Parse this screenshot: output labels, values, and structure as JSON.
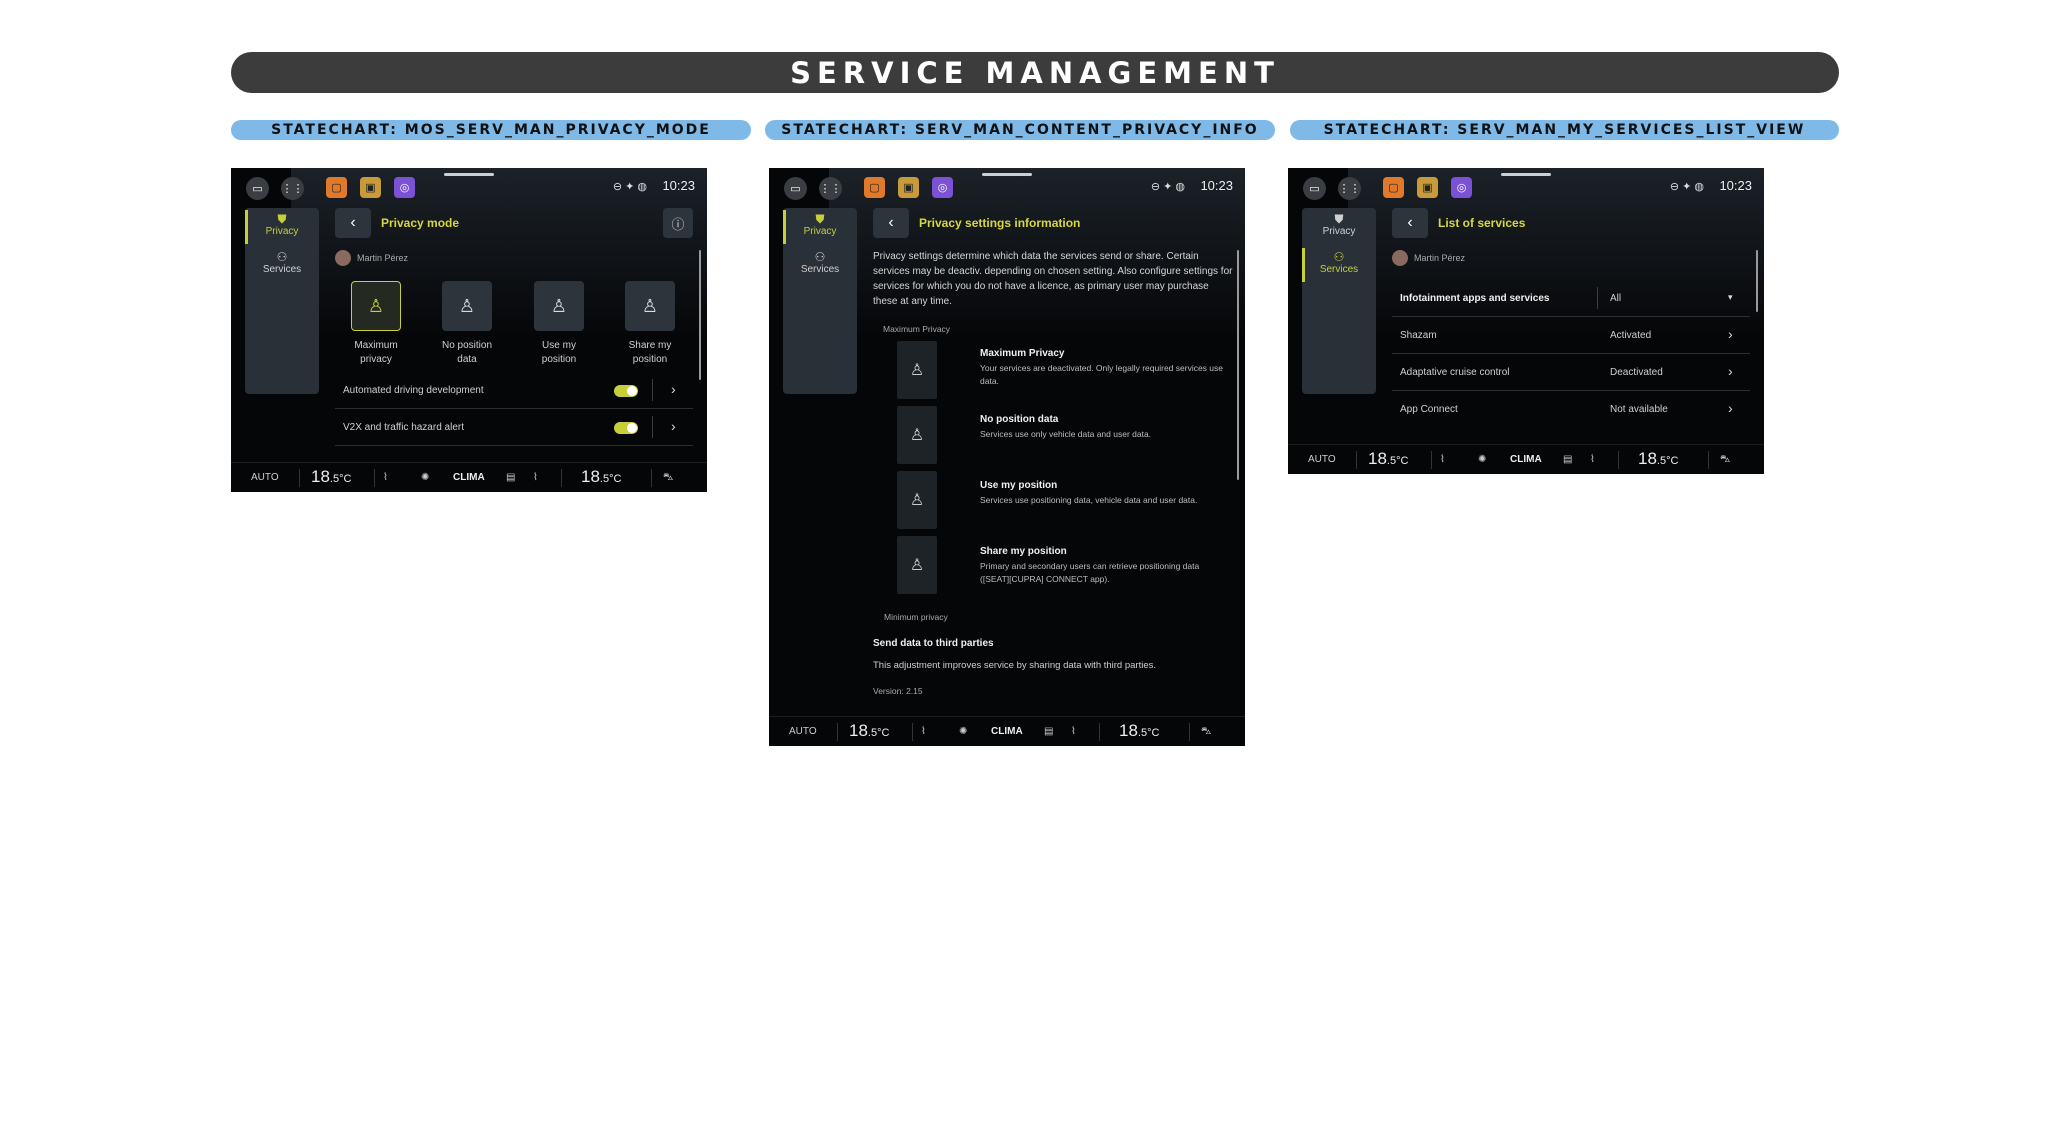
{
  "page": {
    "title": "SERVICE MANAGEMENT",
    "statecharts": [
      "STATECHART: MOS_SERV_MAN_PRIVACY_MODE",
      "STATECHART: SERV_MAN_CONTENT_PRIVACY_INFO",
      "STATECHART: SERV_MAN_MY_SERVICES_LIST_VIEW"
    ]
  },
  "common": {
    "time": "10:23",
    "nav_privacy": "Privacy",
    "nav_services": "Services",
    "user_name": "Martin Pérez",
    "clima": {
      "auto": "AUTO",
      "temp_int": "18",
      "temp_dec": ".5",
      "temp_unit": "°C",
      "label": "CLIMA"
    }
  },
  "screen1": {
    "title": "Privacy mode",
    "modes": [
      {
        "line1": "Maximum",
        "line2": "privacy"
      },
      {
        "line1": "No position",
        "line2": "data"
      },
      {
        "line1": "Use my",
        "line2": "position"
      },
      {
        "line1": "Share my",
        "line2": "position"
      }
    ],
    "rows": [
      "Automated driving development",
      "V2X and traffic hazard alert"
    ]
  },
  "screen2": {
    "title": "Privacy settings information",
    "intro": "Privacy settings determine which data the services send or share. Certain services may be deactiv. depending on chosen setting. Also configure settings for services for which you do not have a licence, as primary user may purchase these at any time.",
    "max_label": "Maximum Privacy",
    "min_label": "Minimum privacy",
    "levels": [
      {
        "title": "Maximum Privacy",
        "desc": "Your services are deactivated. Only legally required services use data."
      },
      {
        "title": "No position data",
        "desc": "Services use only vehicle data and user data."
      },
      {
        "title": "Use my position",
        "desc": "Services use positioning data, vehicle data and user data."
      },
      {
        "title": "Share my position",
        "desc": "Primary and secondary users can retrieve positioning data ([SEAT][CUPRA] CONNECT app)."
      }
    ],
    "third_title": "Send data to third parties",
    "third_desc": "This adjustment improves service by sharing data with third parties.",
    "version": "Version: 2.15"
  },
  "screen3": {
    "title": "List of services",
    "filter_label": "Infotainment apps and services",
    "filter_value": "All",
    "services": [
      {
        "name": "Shazam",
        "status": "Activated"
      },
      {
        "name": "Adaptative cruise control",
        "status": "Deactivated"
      },
      {
        "name": "App Connect",
        "status": "Not available"
      }
    ]
  },
  "colors": {
    "accent": "#c6cf3a",
    "title_bar": "#3c3c3c",
    "statechart_label": "#7fb9e8",
    "screen_bg": "#050608"
  },
  "icons": [
    "card-icon",
    "grid-icon",
    "app-orange-icon",
    "app-gold-icon",
    "app-purple-icon",
    "shield-icon",
    "person-icon",
    "back-arrow-icon",
    "info-icon",
    "chevron-right-icon",
    "chevron-down-icon",
    "seat-heat-icon",
    "fan-icon",
    "car-icon"
  ]
}
